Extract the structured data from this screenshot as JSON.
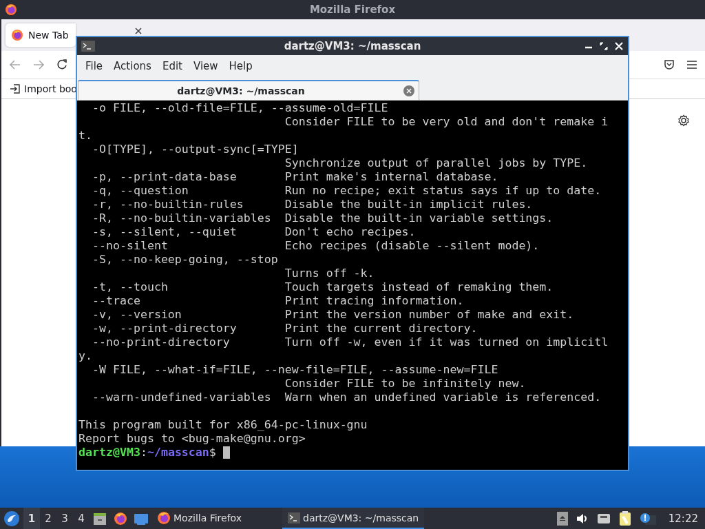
{
  "firefox": {
    "title": "Mozilla Firefox",
    "tabs": [
      {
        "label": "New Tab",
        "selected": true
      }
    ],
    "bookmarks": [
      {
        "label": "Import boo"
      }
    ]
  },
  "terminal": {
    "title": "dartz@VM3: ~/masscan",
    "menu": [
      "File",
      "Actions",
      "Edit",
      "View",
      "Help"
    ],
    "tabs": [
      {
        "label": "dartz@VM3: ~/masscan",
        "selected": true
      }
    ],
    "output": [
      "  -o FILE, --old-file=FILE, --assume-old=FILE",
      "                              Consider FILE to be very old and don't remake i",
      "t.",
      "  -O[TYPE], --output-sync[=TYPE]",
      "                              Synchronize output of parallel jobs by TYPE.",
      "  -p, --print-data-base       Print make's internal database.",
      "  -q, --question              Run no recipe; exit status says if up to date.",
      "  -r, --no-builtin-rules      Disable the built-in implicit rules.",
      "  -R, --no-builtin-variables  Disable the built-in variable settings.",
      "  -s, --silent, --quiet       Don't echo recipes.",
      "  --no-silent                 Echo recipes (disable --silent mode).",
      "  -S, --no-keep-going, --stop",
      "                              Turns off -k.",
      "  -t, --touch                 Touch targets instead of remaking them.",
      "  --trace                     Print tracing information.",
      "  -v, --version               Print the version number of make and exit.",
      "  -w, --print-directory       Print the current directory.",
      "  --no-print-directory        Turn off -w, even if it was turned on implicitl",
      "y.",
      "  -W FILE, --what-if=FILE, --new-file=FILE, --assume-new=FILE",
      "                              Consider FILE to be infinitely new.",
      "  --warn-undefined-variables  Warn when an undefined variable is referenced."
    ],
    "footer": [
      "This program built for x86_64-pc-linux-gnu",
      "Report bugs to <bug-make@gnu.org>"
    ],
    "prompt": {
      "user": "dartz@VM3",
      "separator": ":",
      "path": "~/masscan",
      "symbol": "$"
    }
  },
  "taskbar": {
    "workspaces": [
      {
        "label": "1",
        "selected": true
      },
      {
        "label": "2",
        "selected": false
      },
      {
        "label": "3",
        "selected": false
      },
      {
        "label": "4",
        "selected": false
      }
    ],
    "tasks": [
      {
        "label": "Mozilla Firefox",
        "kind": "browser",
        "selected": false
      },
      {
        "label": "dartz@VM3: ~/masscan",
        "kind": "terminal",
        "selected": true
      }
    ],
    "clock": "12:22"
  }
}
